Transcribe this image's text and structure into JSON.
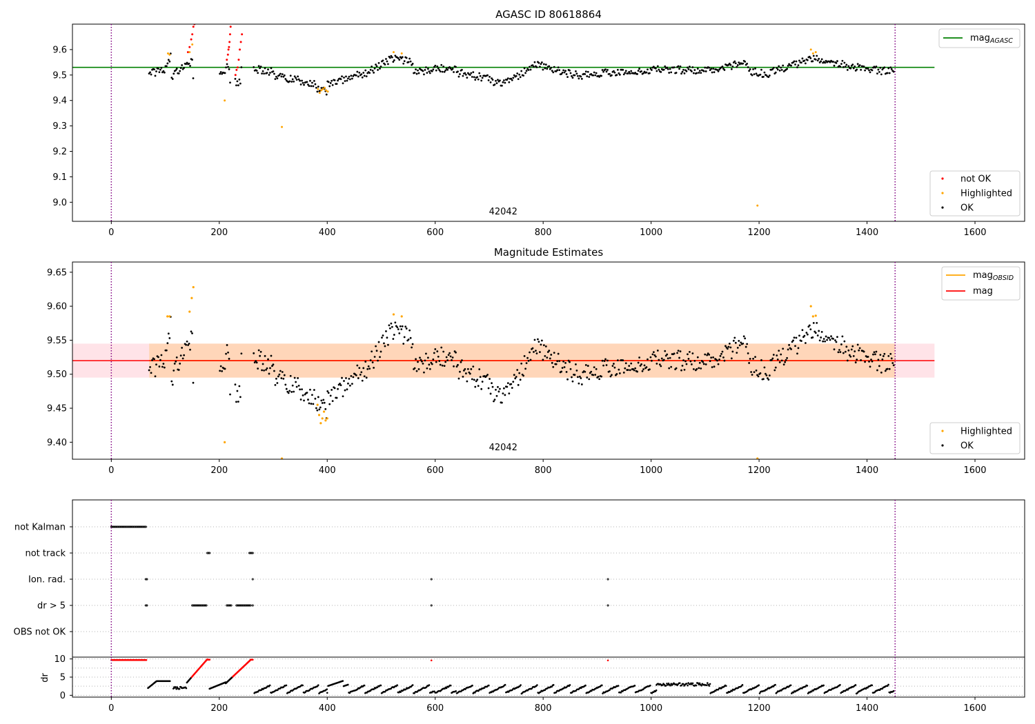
{
  "chart_data": [
    {
      "id": "agasc",
      "type": "scatter",
      "title": "AGASC ID 80618864",
      "xlabel": "",
      "ylabel": "",
      "xlim": [
        -72,
        1692
      ],
      "ylim": [
        8.925,
        9.7
      ],
      "xticks": [
        0,
        200,
        400,
        600,
        800,
        1000,
        1200,
        1400,
        1600
      ],
      "yticks": [
        9.0,
        9.1,
        9.2,
        9.3,
        9.4,
        9.5,
        9.6
      ],
      "ytick_labels": [
        "9.0",
        "9.1",
        "9.2",
        "9.3",
        "9.4",
        "9.5",
        "9.6"
      ],
      "vlines": [
        0,
        1452
      ],
      "annotation": {
        "text": "42042",
        "x": 726,
        "y": 8.965
      },
      "ref_line": {
        "name": "mag",
        "sub": "AGASC",
        "value": 9.53,
        "x0": -72,
        "x1": 1525,
        "color": "#008000"
      },
      "legend_lines": [
        {
          "label": "mag",
          "sub": "AGASC",
          "color": "#008000"
        }
      ],
      "legend_points": [
        {
          "label": "not OK",
          "color": "#ff0000"
        },
        {
          "label": "Highlighted",
          "color": "#ffa500"
        },
        {
          "label": "OK",
          "color": "#000000"
        }
      ],
      "series": [
        {
          "name": "not OK",
          "color": "#ff0000",
          "points": [
            [
              142,
              9.59
            ],
            [
              145,
              9.61
            ],
            [
              148,
              9.64
            ],
            [
              150,
              9.66
            ],
            [
              152,
              9.69
            ],
            [
              154,
              9.7
            ],
            [
              214,
              9.56
            ],
            [
              216,
              9.58
            ],
            [
              217,
              9.6
            ],
            [
              218,
              9.61
            ],
            [
              219,
              9.63
            ],
            [
              220,
              9.66
            ],
            [
              221,
              9.69
            ],
            [
              230,
              9.5
            ],
            [
              232,
              9.52
            ],
            [
              234,
              9.53
            ],
            [
              236,
              9.56
            ],
            [
              238,
              9.6
            ],
            [
              240,
              9.63
            ],
            [
              242,
              9.66
            ]
          ]
        },
        {
          "name": "Highlighted",
          "color": "#ffa500",
          "points": [
            [
              105,
              9.585
            ],
            [
              108,
              9.58
            ],
            [
              145,
              9.59
            ],
            [
              150,
              9.62
            ],
            [
              210,
              9.4
            ],
            [
              316,
              9.296
            ],
            [
              383,
              9.445
            ],
            [
              386,
              9.43
            ],
            [
              389,
              9.44
            ],
            [
              392,
              9.445
            ],
            [
              395,
              9.45
            ],
            [
              398,
              9.44
            ],
            [
              401,
              9.435
            ],
            [
              523,
              9.59
            ],
            [
              538,
              9.585
            ],
            [
              1197,
              8.987
            ],
            [
              1296,
              9.6
            ],
            [
              1300,
              9.585
            ],
            [
              1305,
              9.59
            ]
          ]
        }
      ]
    },
    {
      "id": "mag",
      "type": "scatter",
      "title": "Magnitude Estimates",
      "xlabel": "",
      "ylabel": "",
      "xlim": [
        -72,
        1692
      ],
      "ylim": [
        9.375,
        9.665
      ],
      "xticks": [
        0,
        200,
        400,
        600,
        800,
        1000,
        1200,
        1400,
        1600
      ],
      "yticks": [
        9.4,
        9.45,
        9.5,
        9.55,
        9.6,
        9.65
      ],
      "ytick_labels": [
        "9.40",
        "9.45",
        "9.50",
        "9.55",
        "9.60",
        "9.65"
      ],
      "vlines": [
        0,
        1452
      ],
      "annotation": {
        "text": "42042",
        "x": 726,
        "y": 9.39
      },
      "mag": 9.52,
      "band_outer": [
        9.495,
        9.545
      ],
      "band_inner": [
        9.495,
        9.545
      ],
      "band_x": [
        -72,
        1525
      ],
      "legend_lines": [
        {
          "label": "mag",
          "sub": "OBSID",
          "color": "#ffa500"
        },
        {
          "label": "mag",
          "sub": "",
          "color": "#ff0000"
        }
      ],
      "legend_points": [
        {
          "label": "Highlighted",
          "color": "#ffa500"
        },
        {
          "label": "OK",
          "color": "#000000"
        }
      ],
      "series": [
        {
          "name": "Highlighted",
          "color": "#ffa500",
          "points": [
            [
              104,
              9.585
            ],
            [
              108,
              9.585
            ],
            [
              145,
              9.592
            ],
            [
              149,
              9.612
            ],
            [
              152,
              9.628
            ],
            [
              210,
              9.4
            ],
            [
              316,
              9.376
            ],
            [
              382,
              9.455
            ],
            [
              385,
              9.44
            ],
            [
              388,
              9.428
            ],
            [
              391,
              9.435
            ],
            [
              394,
              9.445
            ],
            [
              397,
              9.432
            ],
            [
              400,
              9.435
            ],
            [
              523,
              9.588
            ],
            [
              538,
              9.585
            ],
            [
              1197,
              9.376
            ],
            [
              1296,
              9.6
            ],
            [
              1300,
              9.585
            ],
            [
              1305,
              9.586
            ]
          ]
        }
      ]
    },
    {
      "id": "flags",
      "type": "scatter",
      "xlim": [
        -72,
        1692
      ],
      "categories": [
        "not Kalman",
        "not track",
        "Ion. rad.",
        "dr > 5",
        "OBS not OK"
      ],
      "vlines": [
        0,
        1452
      ],
      "series": [
        {
          "name": "not Kalman",
          "ranges": [
            [
              0,
              64
            ]
          ]
        },
        {
          "name": "not track",
          "ranges": [
            [
              178,
              182
            ],
            [
              256,
              262
            ]
          ]
        },
        {
          "name": "Ion. rad.",
          "ranges": [
            [
              64,
              67
            ],
            [
              262,
              262
            ],
            [
              593,
              593
            ],
            [
              920,
              920
            ]
          ]
        },
        {
          "name": "dr > 5",
          "ranges": [
            [
              64,
              67
            ],
            [
              150,
              176
            ],
            [
              214,
              222
            ],
            [
              232,
              258
            ],
            [
              262,
              262
            ],
            [
              593,
              593
            ],
            [
              920,
              920
            ]
          ]
        },
        {
          "name": "OBS not OK",
          "ranges": []
        }
      ]
    },
    {
      "id": "dr",
      "type": "scatter",
      "ylabel": "dr",
      "xlim": [
        -72,
        1692
      ],
      "ylim": [
        -0.5,
        10.5
      ],
      "yticks": [
        0,
        5,
        10
      ],
      "ytick_labels": [
        "0",
        "5",
        "10"
      ],
      "xticks": [
        0,
        200,
        400,
        600,
        800,
        1000,
        1200,
        1400,
        1600
      ],
      "vlines": [
        0,
        1452
      ],
      "series": [
        {
          "name": "dr > 5",
          "color": "#ff0000"
        },
        {
          "name": "dr",
          "color": "#000000"
        }
      ]
    }
  ]
}
